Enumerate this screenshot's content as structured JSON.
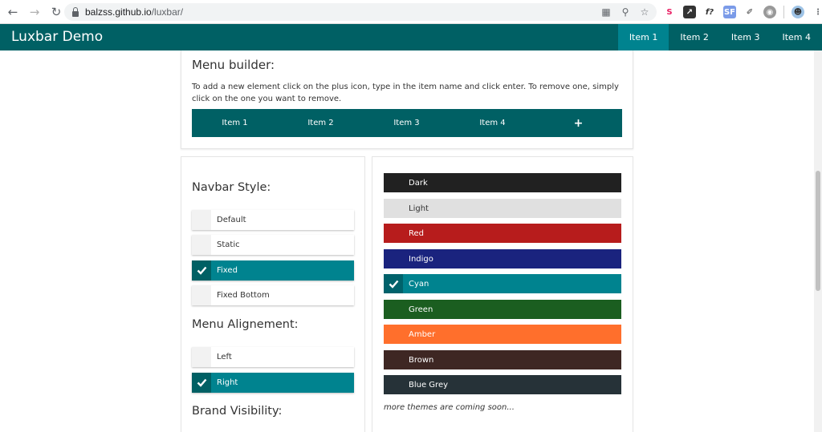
{
  "browser": {
    "url_host": "balzss.github.io",
    "url_path": "/luxbar/",
    "back_icon": "arrow-left",
    "forward_icon": "arrow-right",
    "reload_icon": "reload"
  },
  "navbar": {
    "brand": "Luxbar Demo",
    "items": [
      "Item 1",
      "Item 2",
      "Item 3",
      "Item 4"
    ],
    "active_index": 0,
    "color": "#006064",
    "active_color": "#00838f"
  },
  "builder": {
    "title": "Menu builder:",
    "description": "To add a new element click on the plus icon, type in the item name and click enter. To remove one, simply click on the one you want to remove.",
    "items": [
      "Item 1",
      "Item 2",
      "Item 3",
      "Item 4"
    ],
    "plus": "+"
  },
  "navbar_style": {
    "title": "Navbar Style:",
    "options": [
      {
        "label": "Default",
        "selected": false
      },
      {
        "label": "Static",
        "selected": false
      },
      {
        "label": "Fixed",
        "selected": true
      },
      {
        "label": "Fixed Bottom",
        "selected": false
      }
    ]
  },
  "menu_alignment": {
    "title": "Menu Alignement:",
    "options": [
      {
        "label": "Left",
        "selected": false
      },
      {
        "label": "Right",
        "selected": true
      }
    ]
  },
  "brand_visibility": {
    "title": "Brand Visibility:"
  },
  "themes": {
    "items": [
      {
        "label": "Dark",
        "color": "#212121",
        "text": "#ffffff",
        "selected": false
      },
      {
        "label": "Light",
        "color": "#e0e0e0",
        "text": "#333333",
        "selected": false
      },
      {
        "label": "Red",
        "color": "#b71c1c",
        "text": "#ffffff",
        "selected": false
      },
      {
        "label": "Indigo",
        "color": "#1a237e",
        "text": "#ffffff",
        "selected": false
      },
      {
        "label": "Cyan",
        "color": "#00838f",
        "text": "#ffffff",
        "selected": true
      },
      {
        "label": "Green",
        "color": "#1b5e20",
        "text": "#ffffff",
        "selected": false
      },
      {
        "label": "Amber",
        "color": "#ff6f2c",
        "text": "#ffffff",
        "selected": false
      },
      {
        "label": "Brown",
        "color": "#3e2723",
        "text": "#ffffff",
        "selected": false
      },
      {
        "label": "Blue Grey",
        "color": "#263238",
        "text": "#ffffff",
        "selected": false
      }
    ],
    "more_text": "more themes are coming soon..."
  }
}
